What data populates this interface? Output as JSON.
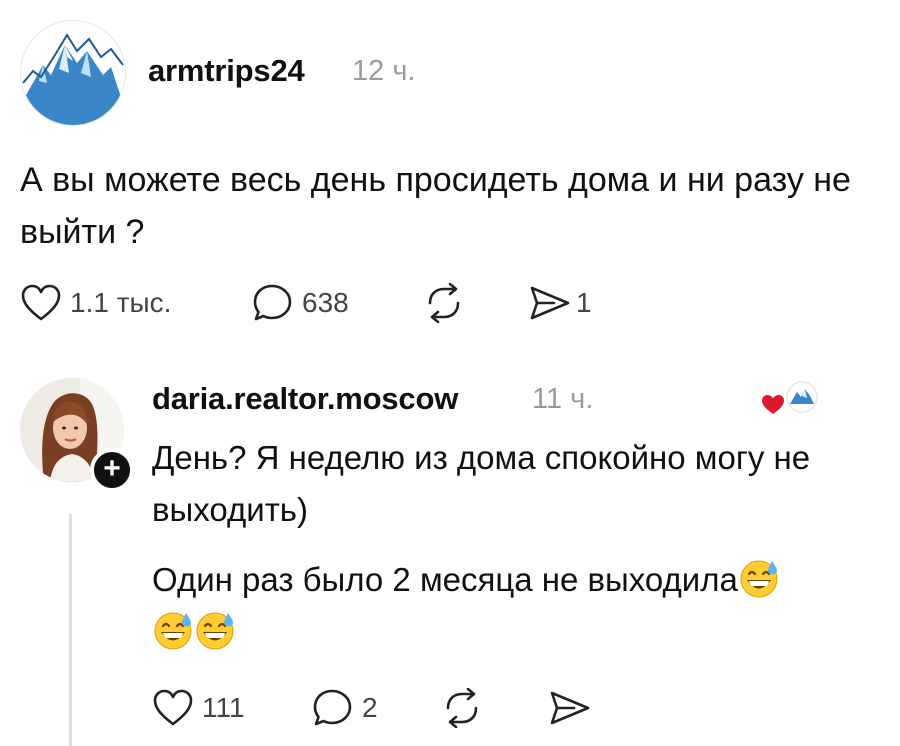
{
  "post": {
    "username": "armtrips24",
    "time": "12 ч.",
    "text": "А вы можете весь день просидеть дома и ни разу не выйти ?",
    "likes": "1.1 тыс.",
    "comments": "638",
    "shares": "1",
    "avatar_icon": "mountains-logo-icon"
  },
  "reply": {
    "username": "daria.realtor.moscow",
    "time": "11 ч.",
    "text_line1": "День? Я неделю из дома спокойно могу не выходить)",
    "text_line2": "Один раз было 2 месяца не выходила",
    "emoji": "grinning-face-with-sweat",
    "likes": "111",
    "comments": "2",
    "follow_symbol": "+",
    "liked_by_author": true
  },
  "colors": {
    "text": "#111111",
    "secondary": "#9a9a9a",
    "heart": "#e0182d",
    "thread_line": "#dedede",
    "mountain_blue": "#3a86c8"
  }
}
